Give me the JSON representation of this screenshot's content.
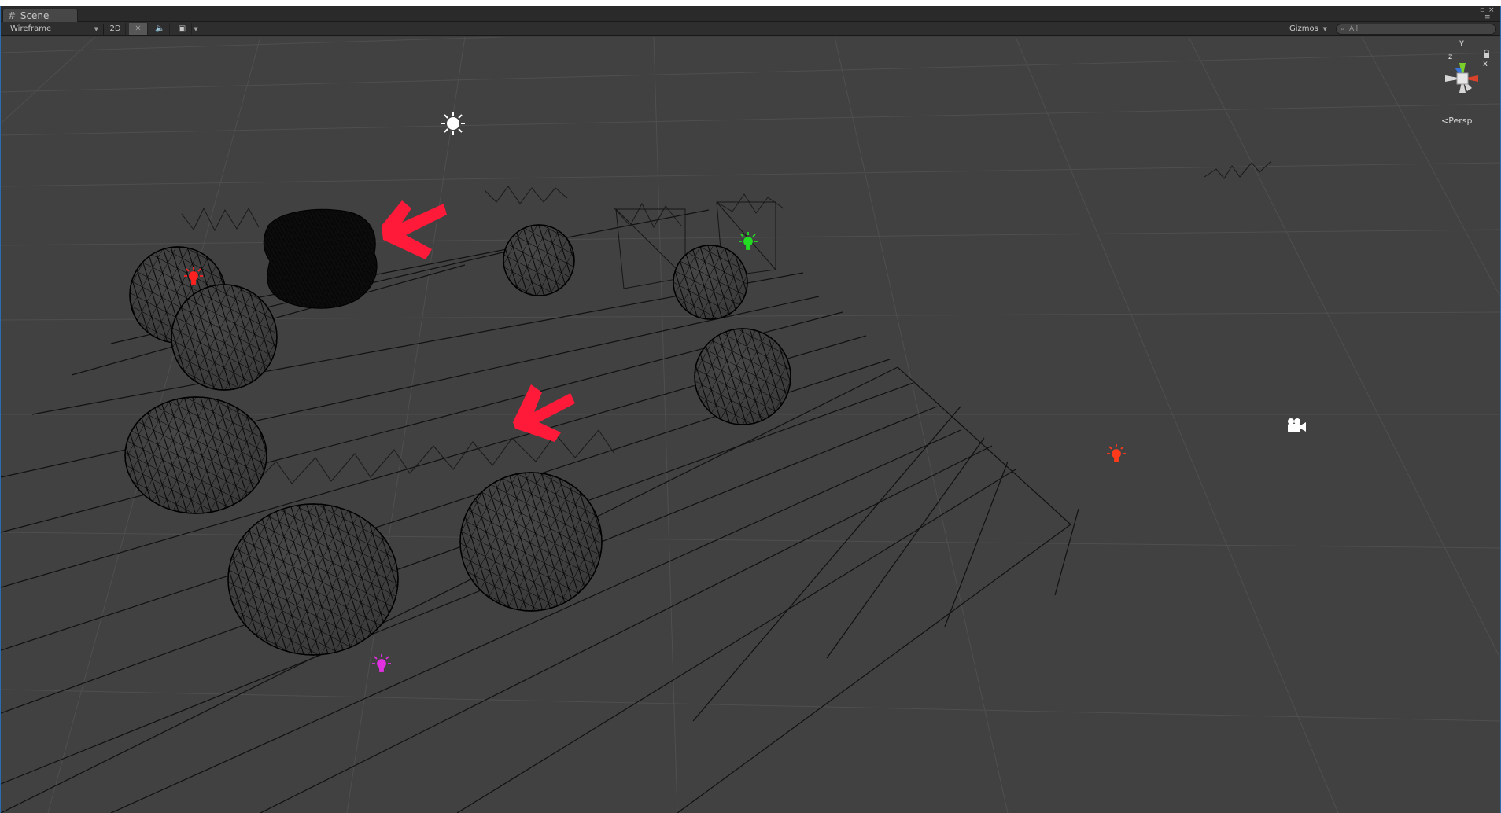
{
  "window": {
    "tab_label": "Scene"
  },
  "toolbar": {
    "render_mode": "Wireframe",
    "mode_2d": "2D",
    "gizmos_label": "Gizmos",
    "search_placeholder": "All"
  },
  "view_gizmo": {
    "y_label": "y",
    "x_label": "x",
    "z_label": "z",
    "projection_label": "Persp"
  },
  "scene": {
    "annotation_arrow_color": "#ff1a3a",
    "light_colors": {
      "directional": "#ffffff",
      "red_light": "#ff2020",
      "green_light": "#22dd22",
      "magenta_light": "#e030e0",
      "orange_light": "#ff3a1a"
    },
    "icons": [
      "sun-icon",
      "point-light-icon",
      "camera-icon"
    ]
  }
}
